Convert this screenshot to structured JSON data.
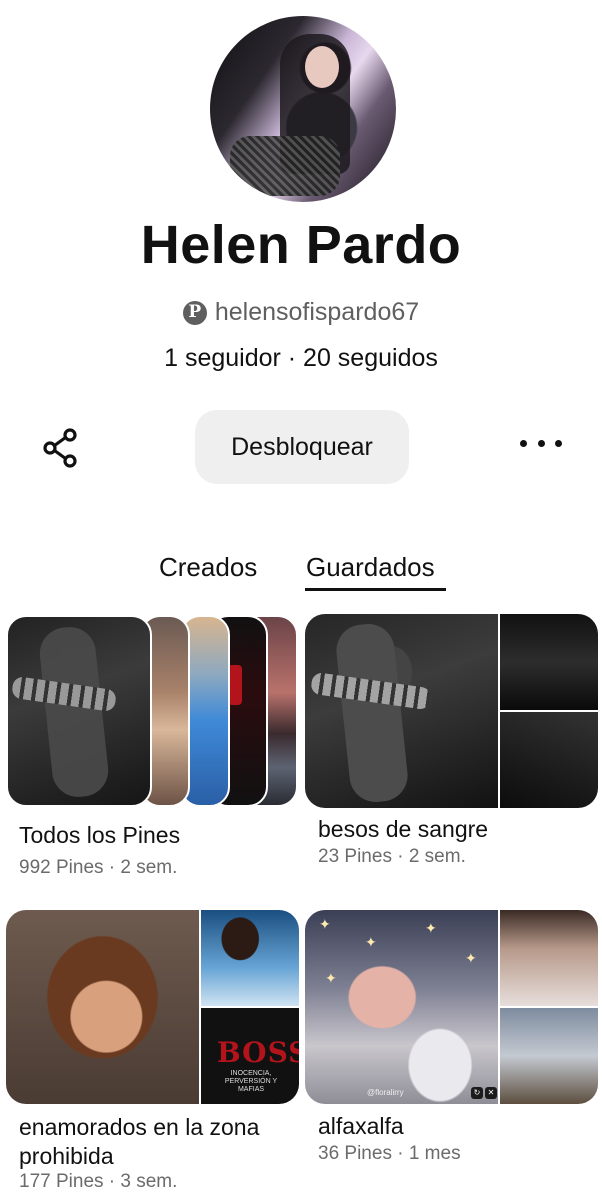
{
  "profile": {
    "name": "Helen Pardo",
    "handle": "helensofispardo67",
    "followers_line": "1 seguidor · 20 seguidos"
  },
  "actions": {
    "unblock_label": "Desbloquear",
    "share_icon": "share-icon",
    "more_icon": "more-options-icon"
  },
  "tabs": [
    {
      "label": "Creados",
      "active": false
    },
    {
      "label": "Guardados",
      "active": true
    }
  ],
  "boards": [
    {
      "title": "Todos los Pines",
      "meta": "992 Pines · 2 sem."
    },
    {
      "title": "besos de sangre",
      "meta": "23 Pines · 2 sem."
    },
    {
      "title": "enamorados en la zona prohibida",
      "meta": "177 Pines · 3 sem."
    },
    {
      "title": "alfaxalfa",
      "meta": "36 Pines · 1 mes"
    }
  ],
  "cover_text": {
    "boss_title": "BOSS",
    "boss_subtitle": "INOCENCIA, PERVERSIÓN Y MAFIAS",
    "watermark": "@floralirry"
  },
  "colors": {
    "primary_text": "#111111",
    "secondary_text": "#5f5f5f",
    "button_bg": "#efefef",
    "background": "#ffffff"
  }
}
